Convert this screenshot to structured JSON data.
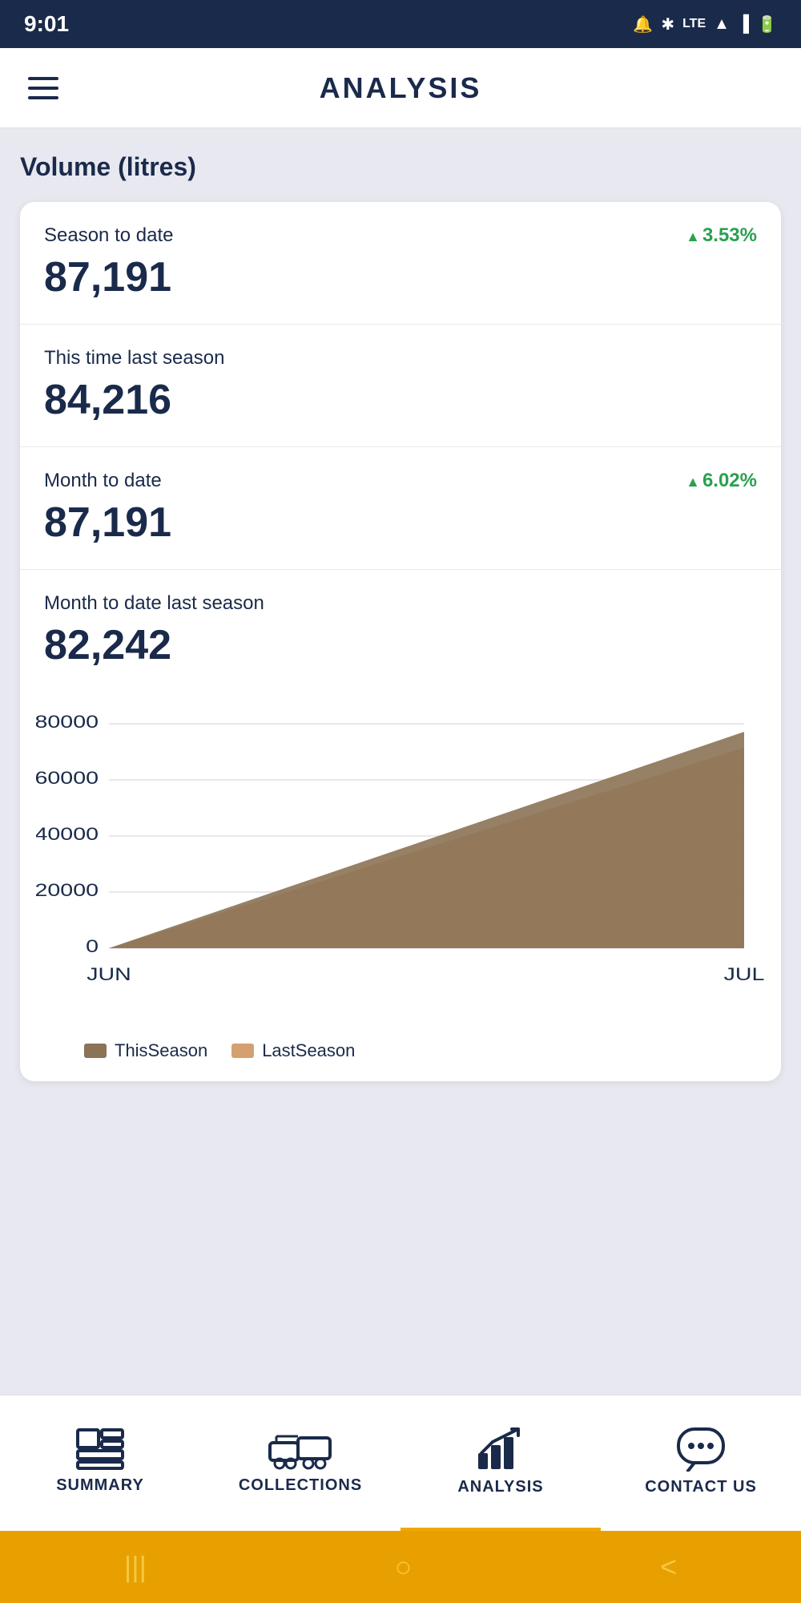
{
  "statusBar": {
    "time": "9:01",
    "icons": [
      "alarm",
      "bluetooth",
      "lte",
      "wifi",
      "signal",
      "battery"
    ]
  },
  "header": {
    "title": "ANALYSIS",
    "menuLabel": "menu"
  },
  "main": {
    "sectionTitle": "Volume (litres)",
    "stats": [
      {
        "label": "Season to date",
        "value": "87,191",
        "badge": "3.53%",
        "hasBadge": true
      },
      {
        "label": "This time last season",
        "value": "84,216",
        "hasBadge": false
      },
      {
        "label": "Month to date",
        "value": "87,191",
        "badge": "6.02%",
        "hasBadge": true
      },
      {
        "label": "Month to date last season",
        "value": "82,242",
        "hasBadge": false
      }
    ],
    "chart": {
      "yAxisLabels": [
        "0",
        "20000",
        "40000",
        "60000",
        "80000"
      ],
      "xAxisLabels": [
        "JUN",
        "JUL"
      ],
      "legend": [
        {
          "label": "ThisSeason",
          "color": "#8b7355"
        },
        {
          "label": "LastSeason",
          "color": "#d4a070"
        }
      ]
    }
  },
  "bottomNav": {
    "items": [
      {
        "label": "SUMMARY",
        "icon": "summary",
        "active": false
      },
      {
        "label": "COLLECTIONS",
        "icon": "collections",
        "active": false
      },
      {
        "label": "ANALYSIS",
        "icon": "analysis",
        "active": true
      },
      {
        "label": "CONTACT US",
        "icon": "contact",
        "active": false
      }
    ]
  },
  "androidNav": {
    "buttons": [
      "|||",
      "○",
      "<"
    ]
  }
}
